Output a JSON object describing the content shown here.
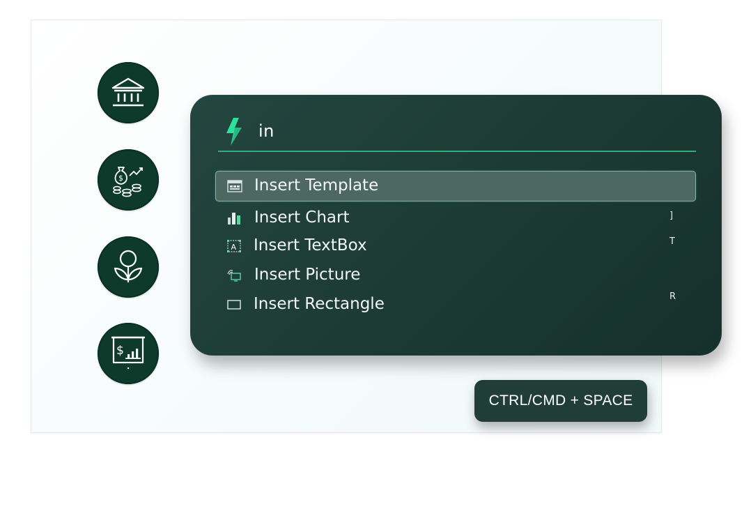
{
  "colors": {
    "circle_bg": "#0e3a2c",
    "palette_bg": "#1d3c35",
    "accent": "#2bb07a",
    "bolt": "#2de29a",
    "selected_bg": "#4d6861"
  },
  "sidebar_icons": [
    {
      "icon": "bank-icon"
    },
    {
      "icon": "money-growth-icon"
    },
    {
      "icon": "plant-icon"
    },
    {
      "icon": "presentation-board-icon"
    }
  ],
  "command_palette": {
    "search_icon": "lightning-bolt-icon",
    "query": "in",
    "items": [
      {
        "label": "Insert Template",
        "icon": "template-icon",
        "shortcut": "",
        "selected": true
      },
      {
        "label": "Insert Chart",
        "icon": "bar-chart-icon",
        "shortcut": "]",
        "selected": false
      },
      {
        "label": "Insert TextBox",
        "icon": "textbox-icon",
        "shortcut": "T",
        "selected": false
      },
      {
        "label": "Insert Picture",
        "icon": "picture-icon",
        "shortcut": "",
        "selected": false
      },
      {
        "label": "Insert Rectangle",
        "icon": "rectangle-icon",
        "shortcut": "R",
        "selected": false
      }
    ]
  },
  "hint_badge": {
    "label": "CTRL/CMD + SPACE"
  }
}
